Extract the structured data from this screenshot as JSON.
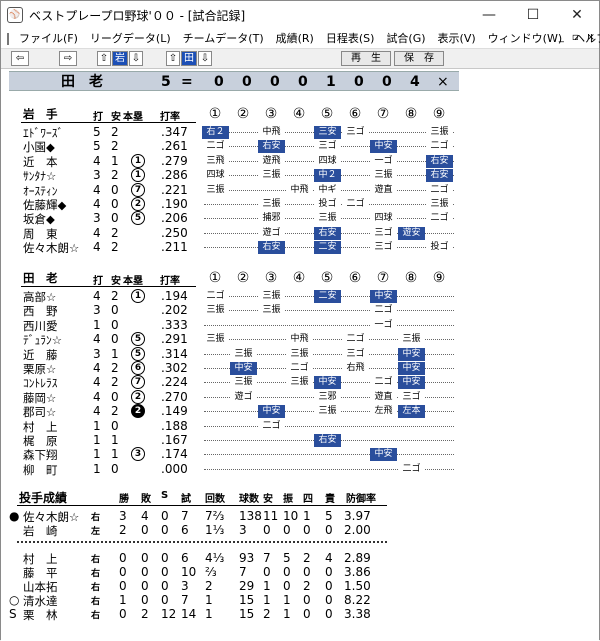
{
  "window": {
    "title": "ベストプレープロ野球'００ - [試合記録]",
    "app_icon": "baseball-cap-icon",
    "controls": [
      "minimize-icon",
      "maximize-icon",
      "close-icon"
    ]
  },
  "menu": {
    "items": [
      "ファイル(F)",
      "リーグデータ(L)",
      "チームデータ(T)",
      "成績(R)",
      "日程表(S)",
      "試合(G)",
      "表示(V)",
      "ウィンドウ(W)",
      "ヘルプ(H)"
    ],
    "mdi": [
      "_",
      "▫",
      "×"
    ]
  },
  "toolbar": {
    "team1": "岩",
    "team2": "田",
    "play": "再　生",
    "save": "保　存"
  },
  "scoreboard": {
    "team": "田　老",
    "total": "5",
    "eq": "=",
    "innings": [
      "0",
      "0",
      "0",
      "0",
      "1",
      "0",
      "0",
      "4"
    ],
    "last": "×"
  },
  "innings_header": [
    "①",
    "②",
    "③",
    "④",
    "⑤",
    "⑥",
    "⑦",
    "⑧",
    "⑨"
  ],
  "team_a": {
    "name": "岩　手",
    "cols": [
      "打",
      "安",
      "本塁",
      "打率"
    ],
    "players": [
      {
        "name": "ｴﾄﾞﾜｰｽﾞ",
        "ab": "5",
        "h": "2",
        "hr": "",
        "avg": ".347",
        "cells": [
          "右２",
          "",
          "中飛",
          "",
          "三安",
          "三ゴ",
          "",
          "",
          "三振"
        ],
        "hits": [
          0,
          4
        ]
      },
      {
        "name": "小園◆",
        "ab": "5",
        "h": "2",
        "hr": "",
        "avg": ".261",
        "cells": [
          "二ゴ",
          "",
          "右安",
          "",
          "三ゴ",
          "",
          "中安",
          "",
          "二ゴ"
        ],
        "hits": [
          2,
          6
        ]
      },
      {
        "name": "近　本",
        "ab": "4",
        "h": "1",
        "hr": "1",
        "avg": ".279",
        "cells": [
          "三飛",
          "",
          "遊飛",
          "",
          "四球",
          "",
          "一ゴ",
          "",
          "右安"
        ],
        "hits": [
          8
        ]
      },
      {
        "name": "ｻﾝﾀﾅ☆",
        "ab": "3",
        "h": "2",
        "hr": "1",
        "avg": ".286",
        "cells": [
          "四球",
          "",
          "三振",
          "",
          "中２",
          "",
          "三振",
          "",
          "右安"
        ],
        "hits": [
          4,
          8
        ]
      },
      {
        "name": "ｵｰｽﾃｨﾝ",
        "ab": "4",
        "h": "0",
        "hr": "7",
        "avg": ".221",
        "cells": [
          "三振",
          "",
          "",
          "中飛",
          "中ギ",
          "",
          "遊直",
          "",
          "二ゴ"
        ],
        "hits": []
      },
      {
        "name": "佐藤輝◆",
        "ab": "4",
        "h": "0",
        "hr": "2",
        "avg": ".190",
        "cells": [
          "",
          "",
          "三振",
          "",
          "投ゴ",
          "二ゴ",
          "",
          "",
          "三振"
        ],
        "hits": []
      },
      {
        "name": "坂倉◆",
        "ab": "3",
        "h": "0",
        "hr": "5",
        "avg": ".206",
        "cells": [
          "",
          "",
          "捕邪",
          "",
          "三振",
          "",
          "四球",
          "",
          "二ゴ"
        ],
        "hits": []
      },
      {
        "name": "周　東",
        "ab": "4",
        "h": "2",
        "hr": "",
        "avg": ".250",
        "cells": [
          "",
          "",
          "遊ゴ",
          "",
          "右安",
          "",
          "三ゴ",
          "遊安",
          ""
        ],
        "hits": [
          4,
          7
        ]
      },
      {
        "name": "佐々木朗☆",
        "ab": "4",
        "h": "2",
        "hr": "",
        "avg": ".211",
        "cells": [
          "",
          "",
          "右安",
          "",
          "二安",
          "",
          "三ゴ",
          "",
          "投ゴ"
        ],
        "hits": [
          2,
          4
        ]
      }
    ]
  },
  "team_b": {
    "name": "田　老",
    "cols": [
      "打",
      "安",
      "本塁",
      "打率"
    ],
    "players": [
      {
        "name": "高部☆",
        "ab": "4",
        "h": "2",
        "hr": "1",
        "avg": ".194",
        "cells": [
          "二ゴ",
          "",
          "三振",
          "",
          "二安",
          "",
          "中安",
          "",
          ""
        ],
        "hits": [
          4,
          6
        ]
      },
      {
        "name": "西　野",
        "ab": "3",
        "h": "0",
        "hr": "",
        "avg": ".202",
        "cells": [
          "三振",
          "",
          "三振",
          "",
          "",
          "",
          "二ゴ",
          "",
          ""
        ],
        "hits": []
      },
      {
        "name": "西川愛",
        "ab": "1",
        "h": "0",
        "hr": "",
        "avg": ".333",
        "cells": [
          "",
          "",
          "",
          "",
          "",
          "",
          "一ゴ",
          "",
          ""
        ],
        "hits": []
      },
      {
        "name": "ﾃﾞｭﾗﾝ☆",
        "ab": "4",
        "h": "0",
        "hr": "5",
        "avg": ".291",
        "cells": [
          "三振",
          "",
          "",
          "中飛",
          "",
          "二ゴ",
          "",
          "三振",
          ""
        ],
        "hits": []
      },
      {
        "name": "近　藤",
        "ab": "3",
        "h": "1",
        "hr": "5",
        "avg": ".314",
        "cells": [
          "",
          "三振",
          "",
          "三振",
          "",
          "三ゴ",
          "",
          "中安",
          ""
        ],
        "hits": [
          7
        ]
      },
      {
        "name": "栗原☆",
        "ab": "4",
        "h": "2",
        "hr": "6",
        "avg": ".302",
        "cells": [
          "",
          "中安",
          "",
          "二ゴ",
          "",
          "右飛",
          "",
          "中安",
          ""
        ],
        "hits": [
          1,
          7
        ]
      },
      {
        "name": "ｺﾝﾄﾚﾗｽ",
        "ab": "4",
        "h": "2",
        "hr": "7",
        "avg": ".224",
        "cells": [
          "",
          "三振",
          "",
          "三振",
          "中安",
          "",
          "二ゴ",
          "中安",
          ""
        ],
        "hits": [
          4,
          7
        ]
      },
      {
        "name": "藤岡☆",
        "ab": "4",
        "h": "0",
        "hr": "2",
        "avg": ".270",
        "cells": [
          "",
          "遊ゴ",
          "",
          "",
          "三邪",
          "",
          "遊直",
          "三ゴ",
          ""
        ],
        "hits": []
      },
      {
        "name": "郡司☆",
        "ab": "4",
        "h": "2",
        "hr": "2",
        "hrfill": true,
        "avg": ".149",
        "cells": [
          "",
          "",
          "中安",
          "",
          "三振",
          "",
          "左飛",
          "左本",
          ""
        ],
        "hits": [
          2,
          7
        ]
      },
      {
        "name": "村　上",
        "ab": "1",
        "h": "0",
        "hr": "",
        "avg": ".188",
        "cells": [
          "",
          "",
          "二ゴ",
          "",
          "",
          "",
          "",
          "",
          ""
        ],
        "hits": []
      },
      {
        "name": "梶　原",
        "ab": "1",
        "h": "1",
        "hr": "",
        "avg": ".167",
        "cells": [
          "",
          "",
          "",
          "",
          "右安",
          "",
          "",
          "",
          ""
        ],
        "hits": [
          4
        ]
      },
      {
        "name": "森下翔",
        "ab": "1",
        "h": "1",
        "hr": "3",
        "avg": ".174",
        "cells": [
          "",
          "",
          "",
          "",
          "",
          "",
          "中安",
          "",
          ""
        ],
        "hits": [
          6
        ]
      },
      {
        "name": "柳　町",
        "ab": "1",
        "h": "0",
        "hr": "",
        "avg": ".000",
        "cells": [
          "",
          "",
          "",
          "",
          "",
          "",
          "",
          "二ゴ",
          ""
        ],
        "hits": []
      }
    ]
  },
  "pitching": {
    "title": "投手成績",
    "cols": [
      "勝",
      "敗",
      "S",
      "試",
      "回数",
      "球数",
      "安",
      "振",
      "四",
      "責",
      "防御率"
    ],
    "top": [
      {
        "mark": "●",
        "name": "佐々木朗☆",
        "hand": "右",
        "w": "3",
        "l": "4",
        "s": "0",
        "g": "7",
        "ip": "7⅔",
        "pc": "138",
        "h": "11",
        "k": "10",
        "bb": "1",
        "er": "5",
        "era": "3.97"
      },
      {
        "mark": "",
        "name": "岩　崎",
        "hand": "左",
        "w": "2",
        "l": "0",
        "s": "0",
        "g": "6",
        "ip": "1⅓",
        "pc": "3",
        "h": "0",
        "k": "0",
        "bb": "0",
        "er": "0",
        "era": "2.00"
      }
    ],
    "bottom": [
      {
        "mark": "",
        "name": "村　上",
        "hand": "右",
        "w": "0",
        "l": "0",
        "s": "0",
        "g": "6",
        "ip": "4⅓",
        "pc": "93",
        "h": "7",
        "k": "5",
        "bb": "2",
        "er": "4",
        "era": "2.89"
      },
      {
        "mark": "",
        "name": "藤　平",
        "hand": "右",
        "w": "0",
        "l": "0",
        "s": "0",
        "g": "10",
        "ip": "⅔",
        "pc": "7",
        "h": "0",
        "k": "0",
        "bb": "0",
        "er": "0",
        "era": "3.86"
      },
      {
        "mark": "",
        "name": "山本拓",
        "hand": "右",
        "w": "0",
        "l": "0",
        "s": "0",
        "g": "3",
        "ip": "2",
        "pc": "29",
        "h": "1",
        "k": "0",
        "bb": "2",
        "er": "0",
        "era": "1.50"
      },
      {
        "mark": "○",
        "name": "清水達",
        "hand": "右",
        "w": "1",
        "l": "0",
        "s": "0",
        "g": "7",
        "ip": "1",
        "pc": "15",
        "h": "1",
        "k": "1",
        "bb": "0",
        "er": "0",
        "era": "8.22"
      },
      {
        "mark": "S",
        "name": "栗　林",
        "hand": "右",
        "w": "0",
        "l": "2",
        "s": "12",
        "g": "14",
        "ip": "1",
        "pc": "15",
        "h": "2",
        "k": "1",
        "bb": "0",
        "er": "0",
        "era": "3.38"
      }
    ]
  }
}
